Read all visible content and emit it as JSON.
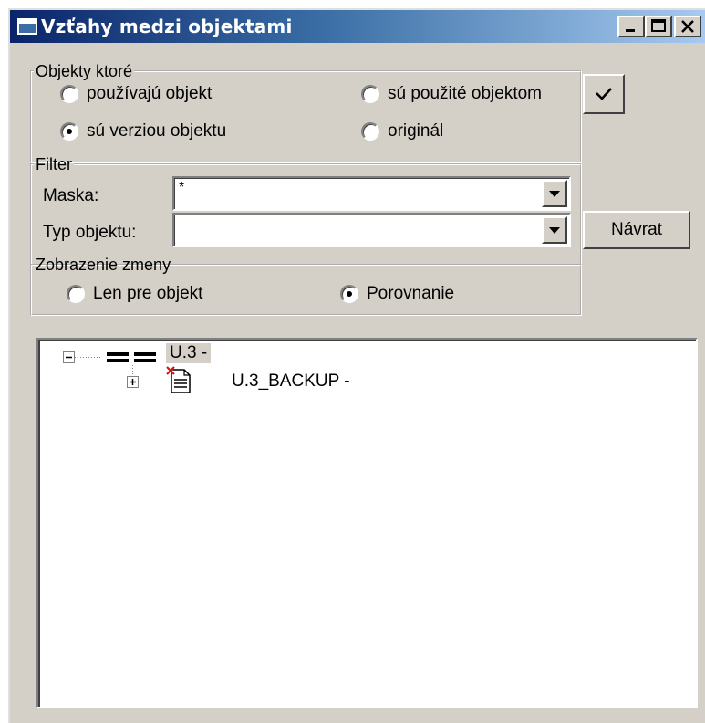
{
  "window": {
    "title": "Vzťahy medzi objektami",
    "controls": {
      "minimize": "minimize-icon",
      "maximize": "maximize-icon",
      "close": "close-icon"
    }
  },
  "objects_group": {
    "legend": "Objekty ktoré",
    "options": [
      {
        "label": "používajú objekt",
        "checked": false
      },
      {
        "label": "sú použité objektom",
        "checked": false
      },
      {
        "label": "sú verziou objektu",
        "checked": true
      },
      {
        "label": "originál",
        "checked": false
      }
    ]
  },
  "filter_group": {
    "legend": "Filter",
    "mask_label": "Maska:",
    "mask_value": "*",
    "type_label": "Typ objektu:",
    "type_value": ""
  },
  "display_group": {
    "legend": "Zobrazenie zmeny",
    "options": [
      {
        "label": "Len pre objekt",
        "checked": false
      },
      {
        "label": "Porovnanie",
        "checked": true
      }
    ]
  },
  "buttons": {
    "confirm_icon": "checkmark-icon",
    "back_prefix": "N",
    "back_rest": "ávrat"
  },
  "tree": {
    "root": {
      "label": "U.3 -",
      "expanded": true,
      "icon": "equals-icon"
    },
    "child": {
      "label": "U.3_BACKUP -",
      "expanded": false,
      "icon": "document-icon"
    }
  }
}
